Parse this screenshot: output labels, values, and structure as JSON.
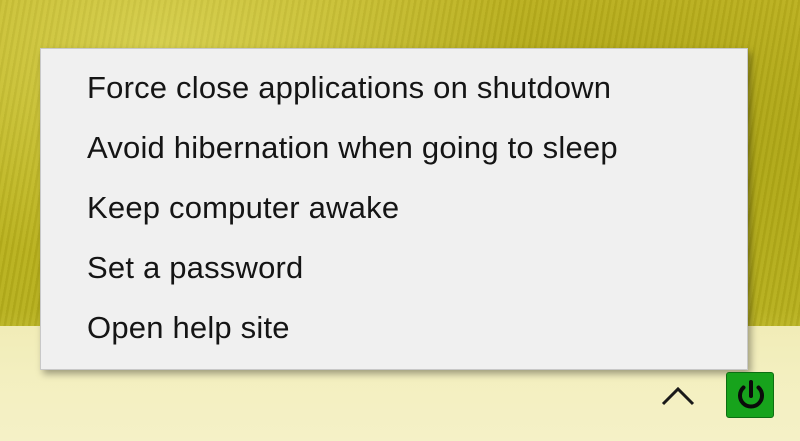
{
  "menu": {
    "items": [
      {
        "label": "Force close applications on shutdown"
      },
      {
        "label": "Avoid hibernation when going to sleep"
      },
      {
        "label": "Keep computer awake"
      },
      {
        "label": "Set a password"
      },
      {
        "label": "Open help site"
      }
    ]
  },
  "tray": {
    "chevron_icon": "chevron-up-icon",
    "app_icon": "power-icon",
    "app_icon_color": "#17a31c"
  }
}
